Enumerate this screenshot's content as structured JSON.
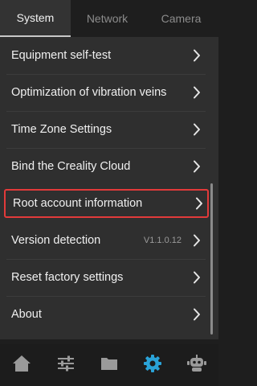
{
  "tabs": [
    {
      "label": "System",
      "active": true
    },
    {
      "label": "Network",
      "active": false
    },
    {
      "label": "Camera",
      "active": false
    }
  ],
  "items": [
    {
      "label": "Equipment self-test"
    },
    {
      "label": "Optimization of vibration veins"
    },
    {
      "label": "Time Zone Settings"
    },
    {
      "label": "Bind the Creality Cloud"
    },
    {
      "label": "Root account information",
      "highlighted": true
    },
    {
      "label": "Version detection",
      "value": "V1.1.0.12"
    },
    {
      "label": "Reset factory settings"
    },
    {
      "label": "About"
    }
  ],
  "bottom_nav": [
    {
      "icon": "home-icon",
      "active": false
    },
    {
      "icon": "sliders-icon",
      "active": false
    },
    {
      "icon": "folder-icon",
      "active": false
    },
    {
      "icon": "gear-icon",
      "active": true
    },
    {
      "icon": "robot-icon",
      "active": false
    }
  ],
  "colors": {
    "highlight_border": "#e23a3a",
    "active_nav": "#2aa3d8",
    "inactive_nav": "#9a9a9a"
  }
}
